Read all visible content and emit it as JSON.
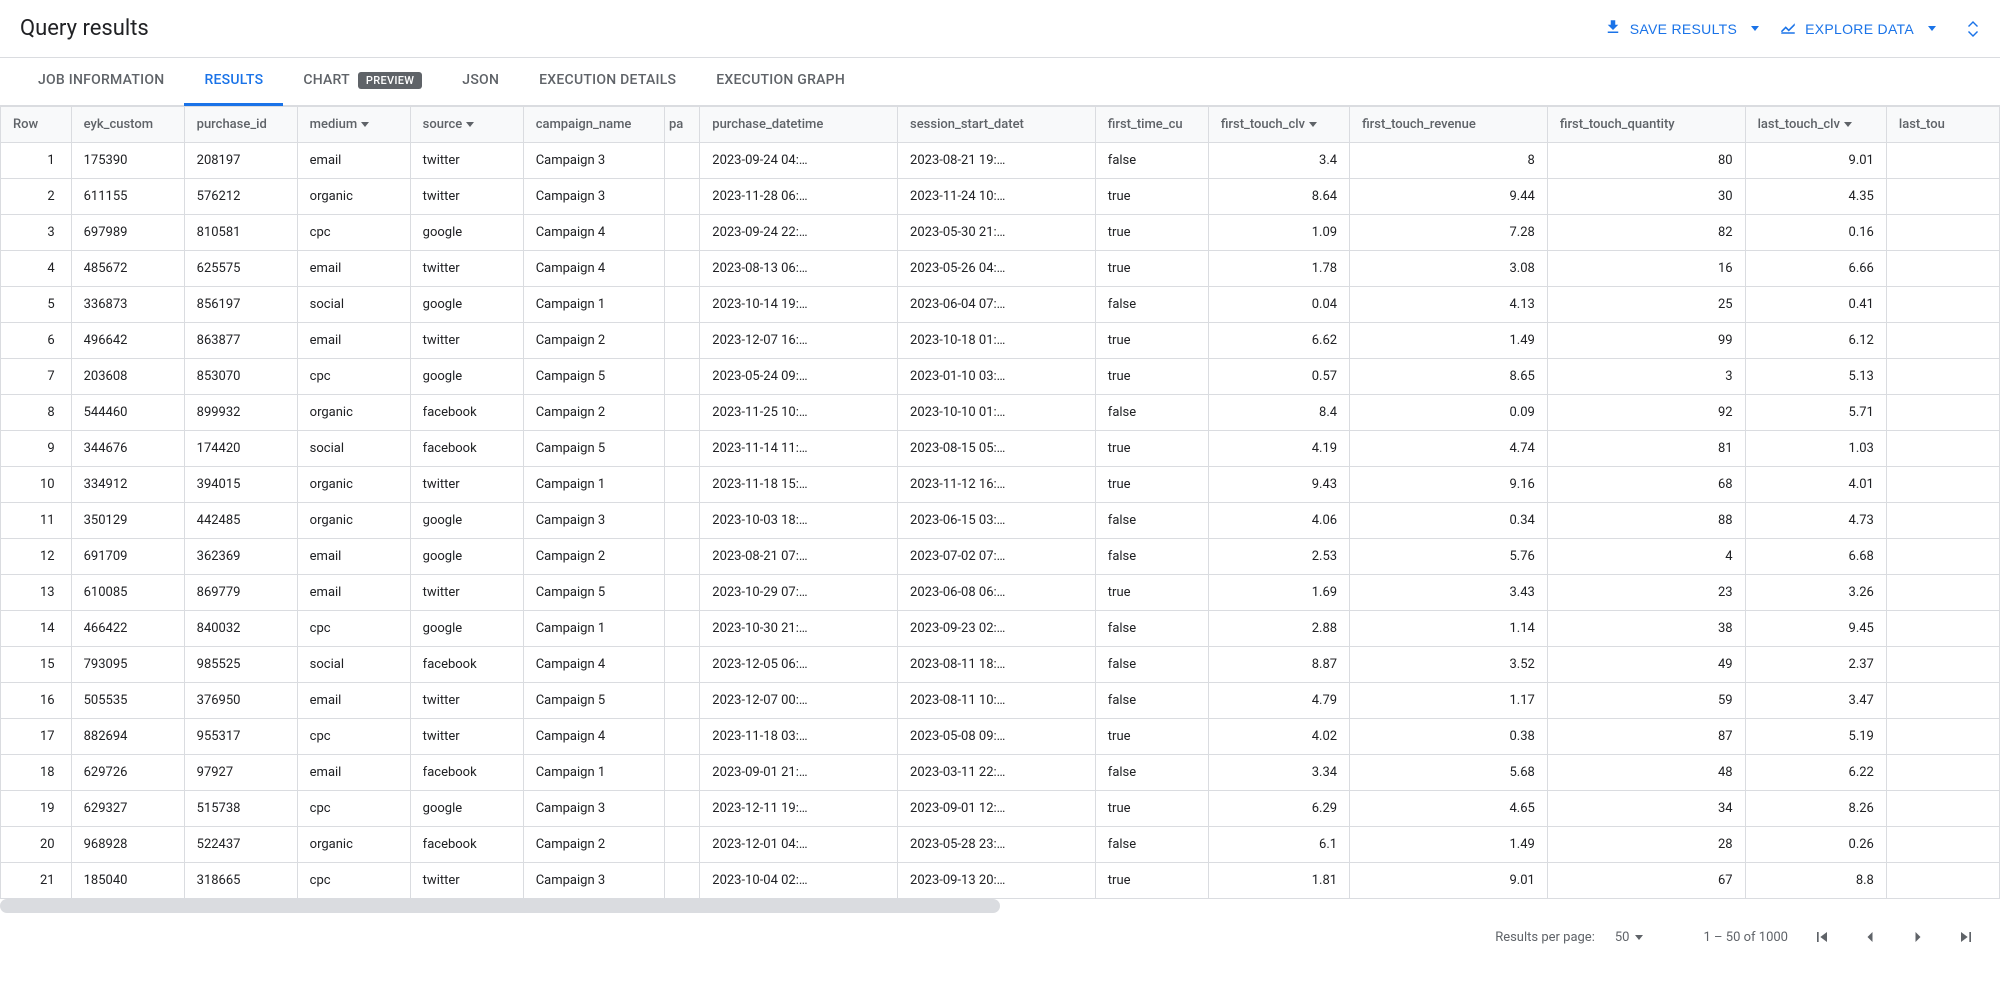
{
  "header": {
    "title": "Query results",
    "save_results": "SAVE RESULTS",
    "explore_data": "EXPLORE DATA"
  },
  "tabs": {
    "job_info": "JOB INFORMATION",
    "results": "RESULTS",
    "chart": "CHART",
    "chart_badge": "PREVIEW",
    "json": "JSON",
    "exec_details": "EXECUTION DETAILS",
    "exec_graph": "EXECUTION GRAPH"
  },
  "columns": {
    "row": "Row",
    "c1": "eyk_custom",
    "c2": "purchase_id",
    "c3": "medium",
    "c4": "source",
    "c5": "campaign_name",
    "c6": "pa",
    "c7": "purchase_datetime",
    "c8": "session_start_datet",
    "c9": "first_time_cu",
    "c10": "first_touch_clv",
    "c11": "first_touch_revenue",
    "c12": "first_touch_quantity",
    "c13": "last_touch_clv",
    "c14": "last_tou"
  },
  "rows": [
    {
      "n": "1",
      "c1": "175390",
      "c2": "208197",
      "c3": "email",
      "c4": "twitter",
      "c5": "Campaign 3",
      "c7": "2023-09-24 04:…",
      "c8": "2023-08-21 19:…",
      "c9": "false",
      "c10": "3.4",
      "c11": "8",
      "c12": "80",
      "c13": "9.01"
    },
    {
      "n": "2",
      "c1": "611155",
      "c2": "576212",
      "c3": "organic",
      "c4": "twitter",
      "c5": "Campaign 3",
      "c7": "2023-11-28 06:…",
      "c8": "2023-11-24 10:…",
      "c9": "true",
      "c10": "8.64",
      "c11": "9.44",
      "c12": "30",
      "c13": "4.35"
    },
    {
      "n": "3",
      "c1": "697989",
      "c2": "810581",
      "c3": "cpc",
      "c4": "google",
      "c5": "Campaign 4",
      "c7": "2023-09-24 22:…",
      "c8": "2023-05-30 21:…",
      "c9": "true",
      "c10": "1.09",
      "c11": "7.28",
      "c12": "82",
      "c13": "0.16"
    },
    {
      "n": "4",
      "c1": "485672",
      "c2": "625575",
      "c3": "email",
      "c4": "twitter",
      "c5": "Campaign 4",
      "c7": "2023-08-13 06:…",
      "c8": "2023-05-26 04:…",
      "c9": "true",
      "c10": "1.78",
      "c11": "3.08",
      "c12": "16",
      "c13": "6.66"
    },
    {
      "n": "5",
      "c1": "336873",
      "c2": "856197",
      "c3": "social",
      "c4": "google",
      "c5": "Campaign 1",
      "c7": "2023-10-14 19:…",
      "c8": "2023-06-04 07:…",
      "c9": "false",
      "c10": "0.04",
      "c11": "4.13",
      "c12": "25",
      "c13": "0.41"
    },
    {
      "n": "6",
      "c1": "496642",
      "c2": "863877",
      "c3": "email",
      "c4": "twitter",
      "c5": "Campaign 2",
      "c7": "2023-12-07 16:…",
      "c8": "2023-10-18 01:…",
      "c9": "true",
      "c10": "6.62",
      "c11": "1.49",
      "c12": "99",
      "c13": "6.12"
    },
    {
      "n": "7",
      "c1": "203608",
      "c2": "853070",
      "c3": "cpc",
      "c4": "google",
      "c5": "Campaign 5",
      "c7": "2023-05-24 09:…",
      "c8": "2023-01-10 03:…",
      "c9": "true",
      "c10": "0.57",
      "c11": "8.65",
      "c12": "3",
      "c13": "5.13"
    },
    {
      "n": "8",
      "c1": "544460",
      "c2": "899932",
      "c3": "organic",
      "c4": "facebook",
      "c5": "Campaign 2",
      "c7": "2023-11-25 10:…",
      "c8": "2023-10-10 01:…",
      "c9": "false",
      "c10": "8.4",
      "c11": "0.09",
      "c12": "92",
      "c13": "5.71"
    },
    {
      "n": "9",
      "c1": "344676",
      "c2": "174420",
      "c3": "social",
      "c4": "facebook",
      "c5": "Campaign 5",
      "c7": "2023-11-14 11:…",
      "c8": "2023-08-15 05:…",
      "c9": "true",
      "c10": "4.19",
      "c11": "4.74",
      "c12": "81",
      "c13": "1.03"
    },
    {
      "n": "10",
      "c1": "334912",
      "c2": "394015",
      "c3": "organic",
      "c4": "twitter",
      "c5": "Campaign 1",
      "c7": "2023-11-18 15:…",
      "c8": "2023-11-12 16:…",
      "c9": "true",
      "c10": "9.43",
      "c11": "9.16",
      "c12": "68",
      "c13": "4.01"
    },
    {
      "n": "11",
      "c1": "350129",
      "c2": "442485",
      "c3": "organic",
      "c4": "google",
      "c5": "Campaign 3",
      "c7": "2023-10-03 18:…",
      "c8": "2023-06-15 03:…",
      "c9": "false",
      "c10": "4.06",
      "c11": "0.34",
      "c12": "88",
      "c13": "4.73"
    },
    {
      "n": "12",
      "c1": "691709",
      "c2": "362369",
      "c3": "email",
      "c4": "google",
      "c5": "Campaign 2",
      "c7": "2023-08-21 07:…",
      "c8": "2023-07-02 07:…",
      "c9": "false",
      "c10": "2.53",
      "c11": "5.76",
      "c12": "4",
      "c13": "6.68"
    },
    {
      "n": "13",
      "c1": "610085",
      "c2": "869779",
      "c3": "email",
      "c4": "twitter",
      "c5": "Campaign 5",
      "c7": "2023-10-29 07:…",
      "c8": "2023-06-08 06:…",
      "c9": "true",
      "c10": "1.69",
      "c11": "3.43",
      "c12": "23",
      "c13": "3.26"
    },
    {
      "n": "14",
      "c1": "466422",
      "c2": "840032",
      "c3": "cpc",
      "c4": "google",
      "c5": "Campaign 1",
      "c7": "2023-10-30 21:…",
      "c8": "2023-09-23 02:…",
      "c9": "false",
      "c10": "2.88",
      "c11": "1.14",
      "c12": "38",
      "c13": "9.45"
    },
    {
      "n": "15",
      "c1": "793095",
      "c2": "985525",
      "c3": "social",
      "c4": "facebook",
      "c5": "Campaign 4",
      "c7": "2023-12-05 06:…",
      "c8": "2023-08-11 18:…",
      "c9": "false",
      "c10": "8.87",
      "c11": "3.52",
      "c12": "49",
      "c13": "2.37"
    },
    {
      "n": "16",
      "c1": "505535",
      "c2": "376950",
      "c3": "email",
      "c4": "twitter",
      "c5": "Campaign 5",
      "c7": "2023-12-07 00:…",
      "c8": "2023-08-11 10:…",
      "c9": "false",
      "c10": "4.79",
      "c11": "1.17",
      "c12": "59",
      "c13": "3.47"
    },
    {
      "n": "17",
      "c1": "882694",
      "c2": "955317",
      "c3": "cpc",
      "c4": "twitter",
      "c5": "Campaign 4",
      "c7": "2023-11-18 03:…",
      "c8": "2023-05-08 09:…",
      "c9": "true",
      "c10": "4.02",
      "c11": "0.38",
      "c12": "87",
      "c13": "5.19"
    },
    {
      "n": "18",
      "c1": "629726",
      "c2": "97927",
      "c3": "email",
      "c4": "facebook",
      "c5": "Campaign 1",
      "c7": "2023-09-01 21:…",
      "c8": "2023-03-11 22:…",
      "c9": "false",
      "c10": "3.34",
      "c11": "5.68",
      "c12": "48",
      "c13": "6.22"
    },
    {
      "n": "19",
      "c1": "629327",
      "c2": "515738",
      "c3": "cpc",
      "c4": "google",
      "c5": "Campaign 3",
      "c7": "2023-12-11 19:…",
      "c8": "2023-09-01 12:…",
      "c9": "true",
      "c10": "6.29",
      "c11": "4.65",
      "c12": "34",
      "c13": "8.26"
    },
    {
      "n": "20",
      "c1": "968928",
      "c2": "522437",
      "c3": "organic",
      "c4": "facebook",
      "c5": "Campaign 2",
      "c7": "2023-12-01 04:…",
      "c8": "2023-05-28 23:…",
      "c9": "false",
      "c10": "6.1",
      "c11": "1.49",
      "c12": "28",
      "c13": "0.26"
    },
    {
      "n": "21",
      "c1": "185040",
      "c2": "318665",
      "c3": "cpc",
      "c4": "twitter",
      "c5": "Campaign 3",
      "c7": "2023-10-04 02:…",
      "c8": "2023-09-13 20:…",
      "c9": "true",
      "c10": "1.81",
      "c11": "9.01",
      "c12": "67",
      "c13": "8.8"
    }
  ],
  "footer": {
    "rpp_label": "Results per page:",
    "rpp_value": "50",
    "range": "1 – 50 of 1000"
  }
}
